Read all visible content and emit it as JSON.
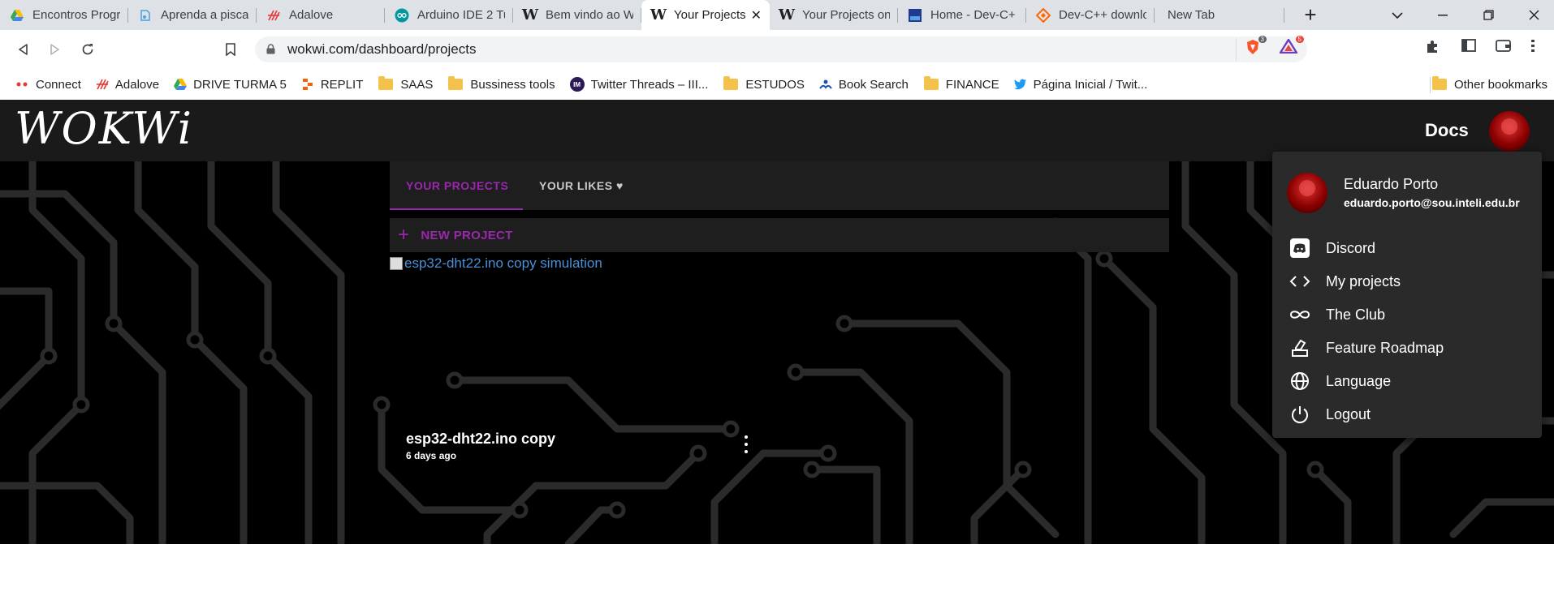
{
  "browser": {
    "tabs": [
      {
        "title": "Encontros Progra",
        "icon": "google-drive-icon"
      },
      {
        "title": "Aprenda a piscar",
        "icon": "doc-icon"
      },
      {
        "title": "Adalove",
        "icon": "adalove-icon"
      },
      {
        "title": "Arduino IDE 2 Tu",
        "icon": "arduino-icon"
      },
      {
        "title": "Bem vindo ao W",
        "icon": "wokwi-icon"
      },
      {
        "title": "Your Projects",
        "icon": "wokwi-icon",
        "active": true
      },
      {
        "title": "Your Projects on",
        "icon": "wokwi-icon"
      },
      {
        "title": "Home - Dev-C+",
        "icon": "devcpp-icon"
      },
      {
        "title": "Dev-C++ downlo",
        "icon": "sourceforge-icon"
      },
      {
        "title": "New Tab",
        "icon": ""
      }
    ],
    "url": "wokwi.com/dashboard/projects",
    "brave_badge": "3",
    "rewards_badge": "5",
    "bookmarks": [
      {
        "label": "Connect",
        "icon": "dots-icon"
      },
      {
        "label": "Adalove",
        "icon": "adalove-icon"
      },
      {
        "label": "DRIVE TURMA 5",
        "icon": "google-drive-icon"
      },
      {
        "label": "REPLIT",
        "icon": "replit-icon"
      },
      {
        "label": "SAAS",
        "icon": "folder-icon"
      },
      {
        "label": "Bussiness tools",
        "icon": "folder-icon"
      },
      {
        "label": "Twitter Threads – III...",
        "icon": "im-icon"
      },
      {
        "label": "ESTUDOS",
        "icon": "folder-icon"
      },
      {
        "label": "Book Search",
        "icon": "book-icon"
      },
      {
        "label": "FINANCE",
        "icon": "folder-icon"
      },
      {
        "label": "Página Inicial / Twit...",
        "icon": "twitter-icon"
      }
    ],
    "other_bookmarks": "Other bookmarks"
  },
  "site": {
    "logo": "WOKWi",
    "docs": "Docs"
  },
  "dashboard": {
    "tabs": [
      "YOUR PROJECTS",
      "YOUR LIKES ♥"
    ],
    "new_project": "NEW PROJECT",
    "project": {
      "image_alt": "esp32-dht22.ino copy simulation",
      "name": "esp32-dht22.ino copy",
      "date": "6 days ago"
    }
  },
  "user_menu": {
    "name": "Eduardo Porto",
    "email": "eduardo.porto@sou.inteli.edu.br",
    "items": [
      {
        "label": "Discord",
        "icon": "discord-icon"
      },
      {
        "label": "My projects",
        "icon": "code-icon"
      },
      {
        "label": "The Club",
        "icon": "infinity-icon"
      },
      {
        "label": "Feature Roadmap",
        "icon": "vote-icon"
      },
      {
        "label": "Language",
        "icon": "globe-icon"
      },
      {
        "label": "Logout",
        "icon": "power-icon"
      }
    ]
  },
  "colors": {
    "accent": "#9b27af",
    "header_bg": "#1a1a1a",
    "panel_bg": "#1e1e1e",
    "menu_bg": "#2a2a2a"
  }
}
